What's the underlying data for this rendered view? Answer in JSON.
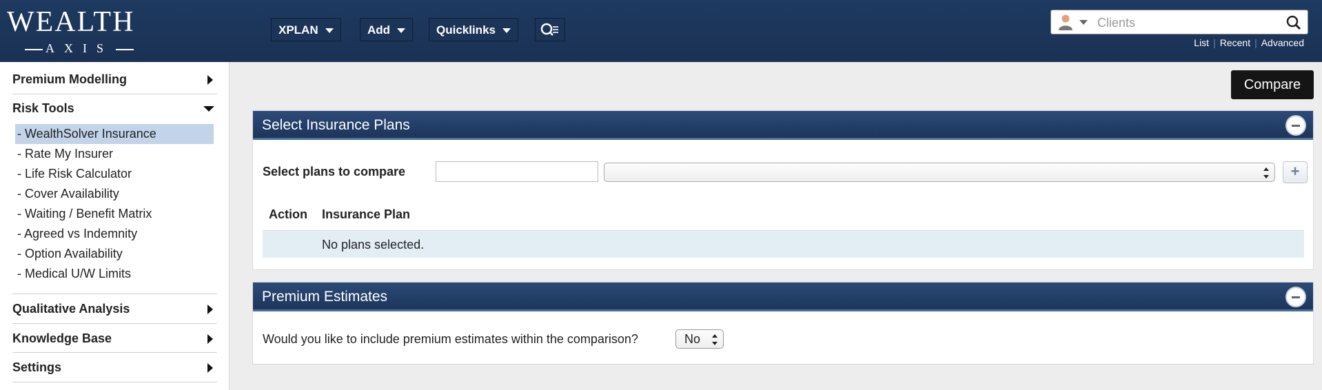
{
  "header": {
    "logo_main": "WEALTH",
    "logo_sub": "AXIS",
    "nav": [
      {
        "label": "XPLAN"
      },
      {
        "label": "Add"
      },
      {
        "label": "Quicklinks"
      }
    ],
    "clients_placeholder": "Clients",
    "links": [
      "List",
      "Recent",
      "Advanced"
    ]
  },
  "sidebar": {
    "sections": [
      {
        "label": "Premium Modelling",
        "state": "collapsed"
      },
      {
        "label": "Risk Tools",
        "state": "expanded"
      },
      {
        "label": "Qualitative Analysis",
        "state": "collapsed"
      },
      {
        "label": "Knowledge Base",
        "state": "collapsed"
      },
      {
        "label": "Settings",
        "state": "collapsed"
      }
    ],
    "risk_items": [
      "- WealthSolver Insurance",
      "- Rate My Insurer",
      "- Life Risk Calculator",
      "- Cover Availability",
      "- Waiting / Benefit Matrix",
      "- Agreed vs Indemnity",
      "- Option Availability",
      "- Medical U/W Limits"
    ],
    "active_item": "- WealthSolver Insurance"
  },
  "main": {
    "compare_button": "Compare",
    "insurance_panel": {
      "title": "Select Insurance Plans",
      "select_label": "Select plans to compare",
      "col_action": "Action",
      "col_plan": "Insurance Plan",
      "empty_text": "No plans selected.",
      "add_symbol": "+"
    },
    "premium_panel": {
      "title": "Premium Estimates",
      "question": "Would you like to include premium estimates within the comparison?",
      "selected_option": "No"
    }
  },
  "colors": {
    "header_bg": "#1d355a",
    "panel_header": "#25426c",
    "active_item_bg": "#c3d3ea",
    "table_band": "#e2eef4",
    "compare_button_bg": "#151515"
  }
}
